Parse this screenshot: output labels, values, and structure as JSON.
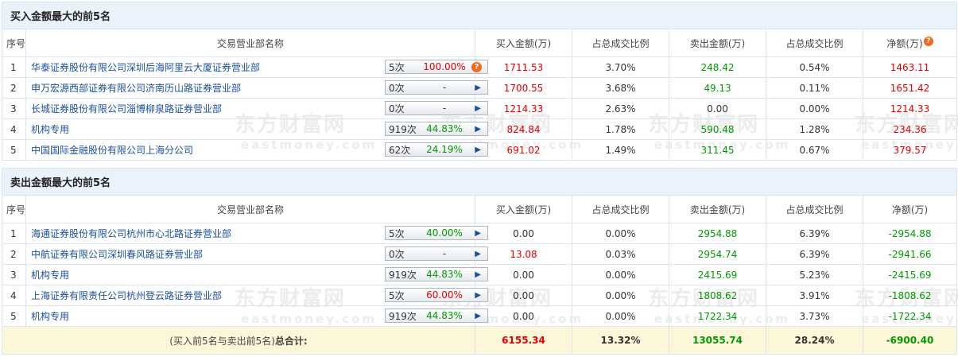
{
  "buy_section": {
    "title": "买入金额最大的前5名",
    "headers": {
      "idx": "序号",
      "name": "交易营业部名称",
      "buy": "买入金额(万)",
      "buy_pct": "占总成交比例",
      "sell": "卖出金额(万)",
      "sell_pct": "占总成交比例",
      "net": "净额(万)"
    },
    "rows": [
      {
        "idx": "1",
        "name": "华泰证券股份有限公司深圳后海阿里云大厦证券营业部",
        "count": "5次",
        "rate": "100.00%",
        "buy": "1711.53",
        "buy_pct": "3.70%",
        "sell": "248.42",
        "sell_pct": "0.54%",
        "net": "1463.11"
      },
      {
        "idx": "2",
        "name": "申万宏源西部证券有限公司济南历山路证券营业部",
        "count": "0次",
        "rate": "-",
        "buy": "1700.55",
        "buy_pct": "3.68%",
        "sell": "49.13",
        "sell_pct": "0.11%",
        "net": "1651.42"
      },
      {
        "idx": "3",
        "name": "长城证券股份有限公司淄博柳泉路证券营业部",
        "count": "0次",
        "rate": "-",
        "buy": "1214.33",
        "buy_pct": "2.63%",
        "sell": "0.00",
        "sell_pct": "0.00%",
        "net": "1214.33"
      },
      {
        "idx": "4",
        "name": "机构专用",
        "count": "919次",
        "rate": "44.83%",
        "buy": "824.84",
        "buy_pct": "1.78%",
        "sell": "590.48",
        "sell_pct": "1.28%",
        "net": "234.36"
      },
      {
        "idx": "5",
        "name": "中国国际金融股份有限公司上海分公司",
        "count": "62次",
        "rate": "24.19%",
        "buy": "691.02",
        "buy_pct": "1.49%",
        "sell": "311.45",
        "sell_pct": "0.67%",
        "net": "379.57"
      }
    ]
  },
  "sell_section": {
    "title": "卖出金额最大的前5名",
    "headers": {
      "idx": "序号",
      "name": "交易营业部名称",
      "buy": "买入金额(万)",
      "buy_pct": "占总成交比例",
      "sell": "卖出金额(万)",
      "sell_pct": "占总成交比例",
      "net": "净额(万)"
    },
    "rows": [
      {
        "idx": "1",
        "name": "海通证券股份有限公司杭州市心北路证券营业部",
        "count": "5次",
        "rate": "40.00%",
        "buy": "0.00",
        "buy_pct": "0.00%",
        "sell": "2954.88",
        "sell_pct": "6.39%",
        "net": "-2954.88"
      },
      {
        "idx": "2",
        "name": "中航证券有限公司深圳春风路证券营业部",
        "count": "0次",
        "rate": "-",
        "buy": "13.08",
        "buy_pct": "0.03%",
        "sell": "2954.74",
        "sell_pct": "6.39%",
        "net": "-2941.66"
      },
      {
        "idx": "3",
        "name": "机构专用",
        "count": "919次",
        "rate": "44.83%",
        "buy": "0.00",
        "buy_pct": "0.00%",
        "sell": "2415.69",
        "sell_pct": "5.23%",
        "net": "-2415.69"
      },
      {
        "idx": "4",
        "name": "上海证券有限责任公司杭州登云路证券营业部",
        "count": "5次",
        "rate": "60.00%",
        "buy": "0.00",
        "buy_pct": "0.00%",
        "sell": "1808.62",
        "sell_pct": "3.91%",
        "net": "-1808.62"
      },
      {
        "idx": "5",
        "name": "机构专用",
        "count": "919次",
        "rate": "44.83%",
        "buy": "0.00",
        "buy_pct": "0.00%",
        "sell": "1722.34",
        "sell_pct": "3.73%",
        "net": "-1722.34"
      }
    ]
  },
  "total": {
    "label": "(买入前5名与卖出前5名)",
    "label_bold": "总合计:",
    "buy": "6155.34",
    "buy_pct": "13.32%",
    "sell": "13055.74",
    "sell_pct": "28.24%",
    "net": "-6900.40"
  },
  "watermark": {
    "cn": "东方财富网",
    "en": "eastmoney.com"
  },
  "badge_symbol": "?",
  "colors": {
    "red": "#e30000",
    "green": "#009a00",
    "header_bg": "#eaf3fb",
    "total_bg": "#fdf7d9",
    "link": "#1a4f9c"
  }
}
